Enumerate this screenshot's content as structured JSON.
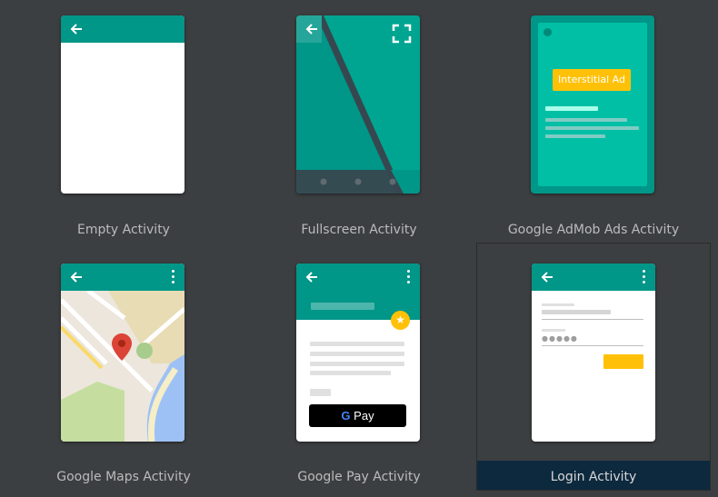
{
  "colors": {
    "background": "#3c3f41",
    "teal": "#009688",
    "teal_light": "#00bfa5",
    "amber": "#ffc107",
    "selected_label_bg": "#0d293e",
    "label_text": "#bbbbbb"
  },
  "templates": [
    {
      "label": "Empty Activity"
    },
    {
      "label": "Fullscreen Activity"
    },
    {
      "label": "Google AdMob Ads Activity",
      "badge": "Interstitial Ad"
    },
    {
      "label": "Google Maps Activity"
    },
    {
      "label": "Google Pay Activity",
      "pay_button": "Pay"
    },
    {
      "label": "Login Activity",
      "selected": true
    }
  ],
  "icons": [
    "back-arrow-icon",
    "fullscreen-icon",
    "overflow-menu-icon",
    "map-pin-icon",
    "star-icon",
    "google-g-icon"
  ]
}
